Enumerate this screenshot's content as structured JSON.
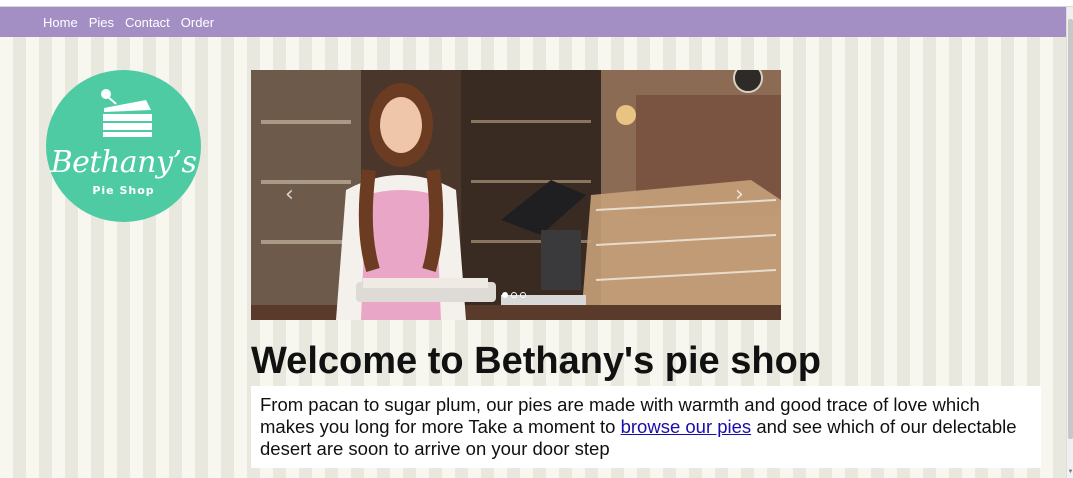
{
  "nav": {
    "items": [
      {
        "label": "Home"
      },
      {
        "label": "Pies"
      },
      {
        "label": "Contact"
      },
      {
        "label": "Order"
      }
    ]
  },
  "logo": {
    "name": "Bethany’s",
    "subtitle": "Pie Shop",
    "icon": "cake-slice-icon"
  },
  "carousel": {
    "prev_icon": "chevron-left-icon",
    "next_icon": "chevron-right-icon",
    "slide_count": 3,
    "active_slide": 1
  },
  "main": {
    "headline": "Welcome to Bethany's pie shop",
    "intro_before": "From pacan to sugar plum, our pies are made with warmth and good trace of love which makes you long for more Take a moment to ",
    "intro_link": "browse our pies",
    "intro_after": " and see which of our delectable desert are soon to arrive on your door step"
  },
  "colors": {
    "navbar": "#a38fc4",
    "logo": "#4ecba3",
    "link": "#1a0dab"
  }
}
